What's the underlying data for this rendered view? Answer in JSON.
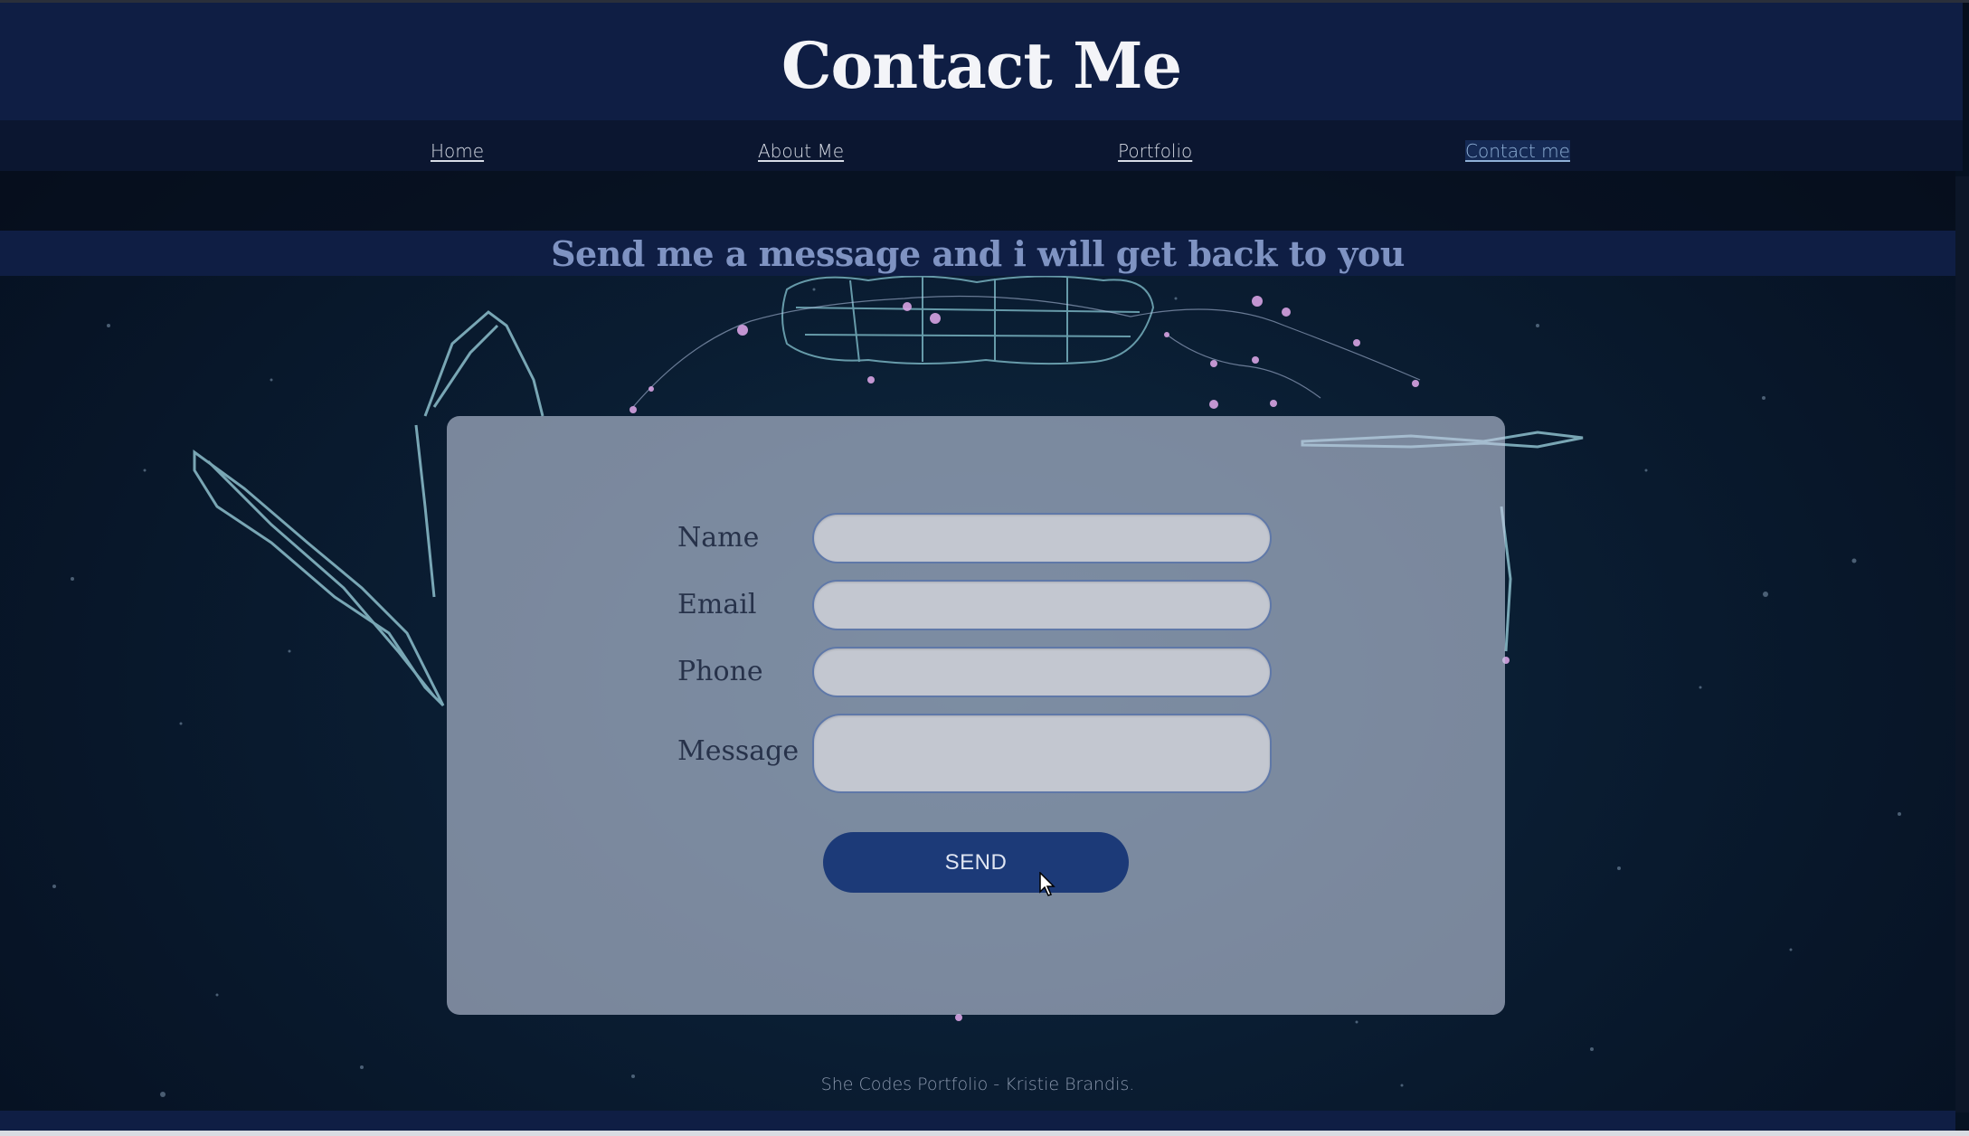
{
  "header": {
    "title": "Contact Me"
  },
  "nav": {
    "items": [
      {
        "label": "Home"
      },
      {
        "label": "About Me"
      },
      {
        "label": "Portfolio"
      },
      {
        "label": "Contact me",
        "active": true
      }
    ]
  },
  "main": {
    "subheading": "Send me a message and i will get back to you",
    "form": {
      "fields": [
        {
          "label": "Name",
          "value": ""
        },
        {
          "label": "Email",
          "value": ""
        },
        {
          "label": "Phone",
          "value": ""
        },
        {
          "label": "Message",
          "value": ""
        }
      ],
      "submit_label": "SEND"
    }
  },
  "footer": {
    "text": "She Codes Portfolio - Kristie Brandis."
  },
  "colors": {
    "header_bg": "#0f1e44",
    "nav_bg": "#0b1630",
    "panel_bg": "#c0cade",
    "button_bg": "#1c3a78",
    "subheading": "#7f93c2"
  },
  "icons": [
    "mouse-pointer-icon"
  ]
}
